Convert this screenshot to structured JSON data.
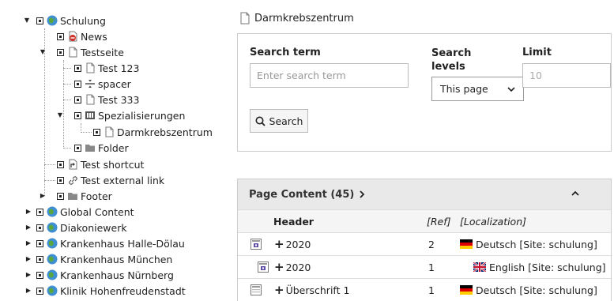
{
  "tree": {
    "items": [
      {
        "label": "Schulung",
        "icon": "globe-icon",
        "toggle": "▼"
      },
      {
        "label": "News",
        "icon": "news-page-icon",
        "toggle": ""
      },
      {
        "label": "Testseite",
        "icon": "page-icon",
        "toggle": "▼"
      },
      {
        "label": "Test 123",
        "icon": "page-icon",
        "toggle": ""
      },
      {
        "label": "spacer",
        "icon": "spacer-icon",
        "toggle": ""
      },
      {
        "label": "Test 333",
        "icon": "page-icon",
        "toggle": ""
      },
      {
        "label": "Spezialisierungen",
        "icon": "columns-icon",
        "toggle": "▼"
      },
      {
        "label": "Darmkrebszentrum",
        "icon": "page-icon",
        "toggle": ""
      },
      {
        "label": "Folder",
        "icon": "folder-icon",
        "toggle": ""
      },
      {
        "label": "Test shortcut",
        "icon": "shortcut-icon",
        "toggle": ""
      },
      {
        "label": "Test external link",
        "icon": "link-icon",
        "toggle": ""
      },
      {
        "label": "Footer",
        "icon": "folder-icon",
        "toggle": "▶"
      },
      {
        "label": "Global Content",
        "icon": "globe-icon",
        "toggle": "▶"
      },
      {
        "label": "Diakoniewerk",
        "icon": "globe-icon",
        "toggle": "▶"
      },
      {
        "label": "Krankenhaus Halle-Dölau",
        "icon": "globe-icon",
        "toggle": "▶"
      },
      {
        "label": "Krankenhaus München",
        "icon": "globe-icon",
        "toggle": "▶"
      },
      {
        "label": "Krankenhaus Nürnberg",
        "icon": "globe-icon",
        "toggle": "▶"
      },
      {
        "label": "Klinik Hohenfreudenstadt",
        "icon": "globe-icon",
        "toggle": "▶"
      }
    ]
  },
  "breadcrumb": {
    "title": "Darmkrebszentrum"
  },
  "search": {
    "term_label": "Search term",
    "term_placeholder": "Enter search term",
    "levels_label": "Search levels",
    "levels_value": "This page",
    "limit_label": "Limit",
    "limit_placeholder": "10",
    "button_label": "Search"
  },
  "page_content": {
    "title": "Page Content (45)",
    "columns": {
      "header": "Header",
      "ref": "[Ref]",
      "localization": "[Localization]"
    },
    "rows": [
      {
        "header": "2020",
        "ref": "2",
        "localization": "Deutsch [Site: schulung]",
        "flag": "de"
      },
      {
        "header": "2020",
        "ref": "1",
        "localization": "English [Site: schulung]",
        "flag": "gb"
      },
      {
        "header": "Überschrift 1",
        "ref": "1",
        "localization": "Deutsch [Site: schulung]",
        "flag": "de"
      }
    ]
  },
  "colors": {
    "globe": "#4a9a2e",
    "news": "#c8312b",
    "accent": "#5e4aa5"
  }
}
